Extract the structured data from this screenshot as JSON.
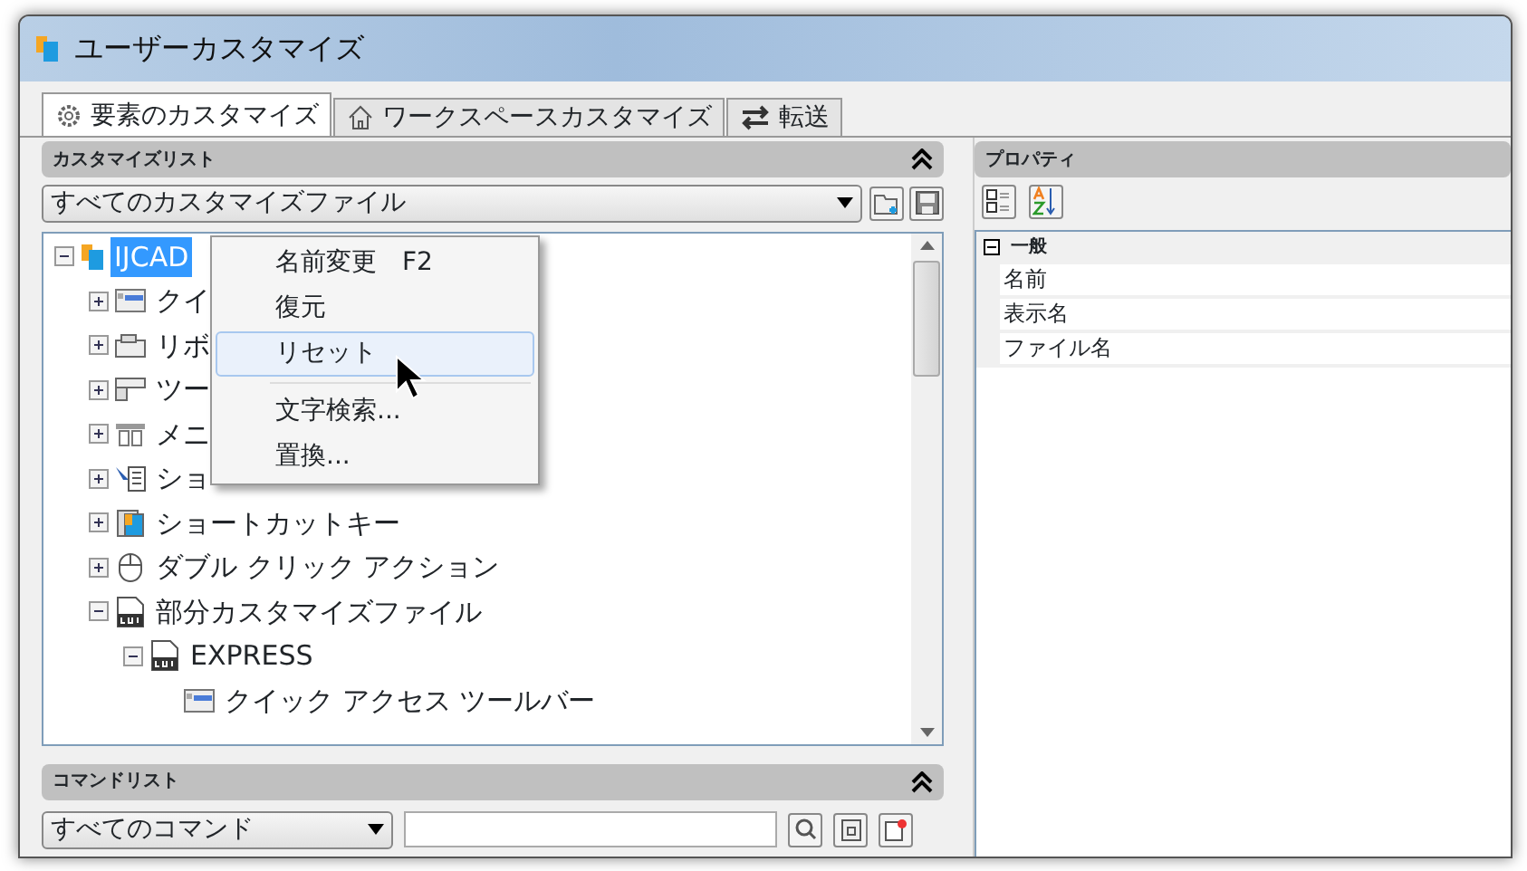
{
  "window": {
    "title": "ユーザーカスタマイズ"
  },
  "tabs": [
    {
      "label": "要素のカスタマイズ",
      "selected": true,
      "kind": "gear"
    },
    {
      "label": "ワークスペースカスタマイズ",
      "selected": false,
      "kind": "home"
    },
    {
      "label": "転送",
      "selected": false,
      "kind": "transfer"
    }
  ],
  "customize_list": {
    "title": "カスタマイズリスト",
    "filter": {
      "value": "すべてのカスタマイズファイル"
    },
    "tree": [
      {
        "label": "IJCAD",
        "kind": "app",
        "expanded": true,
        "selected": true,
        "children": [
          {
            "label": "クイ",
            "kind": "toolbar",
            "expanded": false,
            "selected": false
          },
          {
            "label": "リボ",
            "kind": "ribbon",
            "expanded": false,
            "selected": false
          },
          {
            "label": "ツー",
            "kind": "toolbars",
            "expanded": false,
            "selected": false
          },
          {
            "label": "メニ",
            "kind": "menu",
            "expanded": false,
            "selected": false
          },
          {
            "label": "ショ",
            "kind": "shortcut-menu",
            "expanded": false,
            "selected": false
          },
          {
            "label": "ショートカットキー",
            "kind": "shortcut-keys",
            "expanded": false,
            "selected": false
          },
          {
            "label": "ダブル クリック アクション",
            "kind": "double-click",
            "expanded": false,
            "selected": false
          },
          {
            "label": "部分カスタマイズファイル",
            "kind": "cui",
            "expanded": true,
            "selected": false,
            "children": [
              {
                "label": "EXPRESS",
                "kind": "cui",
                "expanded": true,
                "selected": false,
                "children": [
                  {
                    "label": "クイック アクセス ツールバー",
                    "kind": "toolbar",
                    "selected": false
                  }
                ]
              }
            ]
          }
        ]
      }
    ]
  },
  "context_menu": [
    {
      "kind": "item",
      "label": "名前変更",
      "shortcut": "F2",
      "highlighted": false
    },
    {
      "kind": "item",
      "label": "復元",
      "highlighted": false
    },
    {
      "kind": "item",
      "label": "リセット",
      "highlighted": true
    },
    {
      "kind": "separator"
    },
    {
      "kind": "item",
      "label": "文字検索...",
      "highlighted": false
    },
    {
      "kind": "item",
      "label": "置換...",
      "highlighted": false
    }
  ],
  "command_list": {
    "title": "コマンドリスト",
    "filter": {
      "value": "すべてのコマンド"
    }
  },
  "properties": {
    "title": "プロパティ",
    "groups": [
      {
        "label": "一般",
        "expanded": true,
        "rows": [
          {
            "name": "名前"
          },
          {
            "name": "表示名"
          },
          {
            "name": "ファイル名"
          }
        ]
      }
    ]
  }
}
